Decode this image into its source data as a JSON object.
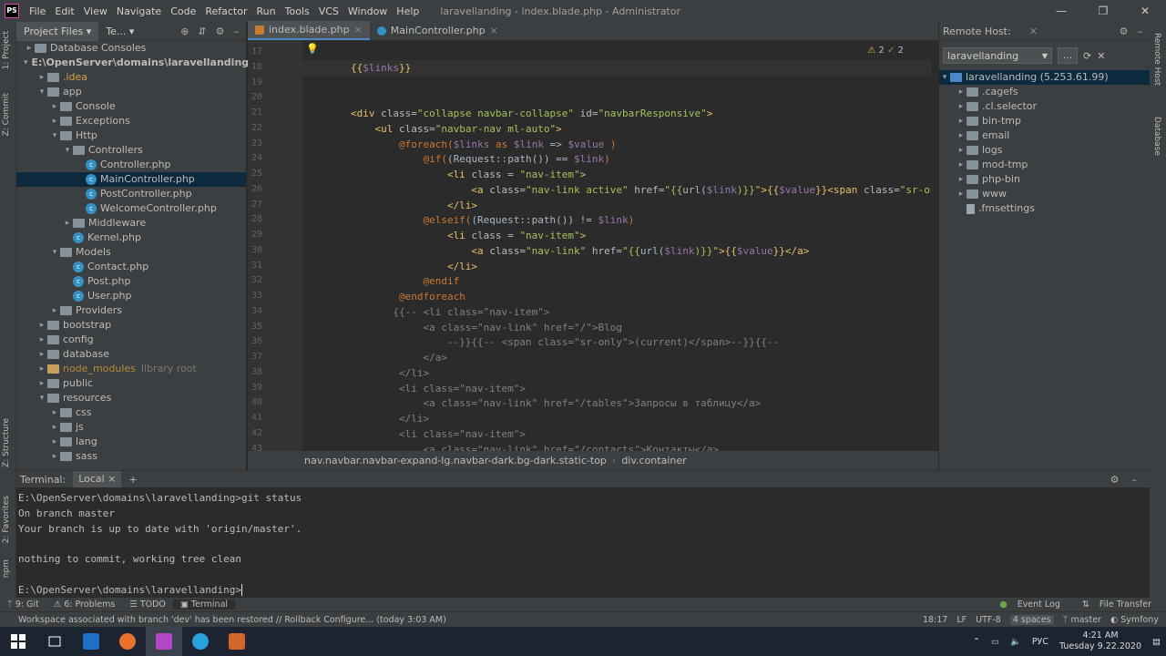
{
  "window": {
    "title": "laravellanding - index.blade.php - Administrator",
    "logo": "PS",
    "controls": [
      "—",
      "❐",
      "✕"
    ]
  },
  "menu": [
    "File",
    "Edit",
    "View",
    "Navigate",
    "Code",
    "Refactor",
    "Run",
    "Tools",
    "VCS",
    "Window",
    "Help"
  ],
  "left_strip": [
    "1: Project",
    "Z: Commit",
    "Z: Structure",
    "2: Favorites",
    "npm"
  ],
  "right_strip": [
    "Remote Host",
    "Database"
  ],
  "project_panel": {
    "tabs": [
      "Project Files",
      "Te..."
    ],
    "tree": [
      {
        "label": "Database Consoles",
        "depth": 1,
        "kind": "folder",
        "expanded": false
      },
      {
        "label": "E:\\OpenServer\\domains\\laravellanding",
        "depth": 1,
        "kind": "folder",
        "expanded": true,
        "bold": true
      },
      {
        "label": ".idea",
        "depth": 2,
        "kind": "folder",
        "expanded": false,
        "style": "idea"
      },
      {
        "label": "app",
        "depth": 2,
        "kind": "folder",
        "expanded": true
      },
      {
        "label": "Console",
        "depth": 3,
        "kind": "folder",
        "expanded": false
      },
      {
        "label": "Exceptions",
        "depth": 3,
        "kind": "folder",
        "expanded": false
      },
      {
        "label": "Http",
        "depth": 3,
        "kind": "folder",
        "expanded": true
      },
      {
        "label": "Controllers",
        "depth": 4,
        "kind": "folder",
        "expanded": true
      },
      {
        "label": "Controller.php",
        "depth": 5,
        "kind": "class"
      },
      {
        "label": "MainController.php",
        "depth": 5,
        "kind": "class",
        "selected": true
      },
      {
        "label": "PostController.php",
        "depth": 5,
        "kind": "class"
      },
      {
        "label": "WelcomeController.php",
        "depth": 5,
        "kind": "class"
      },
      {
        "label": "Middleware",
        "depth": 4,
        "kind": "folder",
        "expanded": false
      },
      {
        "label": "Kernel.php",
        "depth": 4,
        "kind": "class"
      },
      {
        "label": "Models",
        "depth": 3,
        "kind": "folder",
        "expanded": true
      },
      {
        "label": "Contact.php",
        "depth": 4,
        "kind": "class"
      },
      {
        "label": "Post.php",
        "depth": 4,
        "kind": "class"
      },
      {
        "label": "User.php",
        "depth": 4,
        "kind": "class"
      },
      {
        "label": "Providers",
        "depth": 3,
        "kind": "folder",
        "expanded": false
      },
      {
        "label": "bootstrap",
        "depth": 2,
        "kind": "folder",
        "expanded": false
      },
      {
        "label": "config",
        "depth": 2,
        "kind": "folder",
        "expanded": false
      },
      {
        "label": "database",
        "depth": 2,
        "kind": "folder",
        "expanded": false
      },
      {
        "label": "node_modules",
        "depth": 2,
        "kind": "folder",
        "expanded": false,
        "style": "excl",
        "sub": "library root"
      },
      {
        "label": "public",
        "depth": 2,
        "kind": "folder",
        "expanded": false
      },
      {
        "label": "resources",
        "depth": 2,
        "kind": "folder",
        "expanded": true
      },
      {
        "label": "css",
        "depth": 3,
        "kind": "folder",
        "expanded": false
      },
      {
        "label": "js",
        "depth": 3,
        "kind": "folder",
        "expanded": false
      },
      {
        "label": "lang",
        "depth": 3,
        "kind": "folder",
        "expanded": false
      },
      {
        "label": "sass",
        "depth": 3,
        "kind": "folder",
        "expanded": false
      }
    ]
  },
  "editor": {
    "tabs": [
      {
        "label": "index.blade.php",
        "active": true
      },
      {
        "label": "MainController.php",
        "active": false
      }
    ],
    "inspection": {
      "warnings": "2",
      "ok": "2"
    },
    "first_line": 17,
    "current_line": 18,
    "lines": [
      [],
      [
        [
          "        {{",
          "t"
        ],
        [
          "$links",
          "v"
        ],
        [
          "}}",
          "t"
        ]
      ],
      [],
      [],
      [
        [
          "        <div ",
          "t"
        ],
        [
          "class=",
          "a"
        ],
        [
          "\"collapse navbar-collapse\" ",
          "s"
        ],
        [
          "id=",
          "a"
        ],
        [
          "\"navbarResponsive\"",
          "s"
        ],
        [
          ">",
          "t"
        ]
      ],
      [
        [
          "            <ul ",
          "t"
        ],
        [
          "class=",
          "a"
        ],
        [
          "\"navbar-nav ml-auto\"",
          "s"
        ],
        [
          ">",
          "t"
        ]
      ],
      [
        [
          "                @foreach(",
          "b"
        ],
        [
          "$links",
          "v"
        ],
        [
          " as ",
          "b"
        ],
        [
          "$link",
          "v"
        ],
        [
          " => ",
          "p"
        ],
        [
          "$value",
          "v"
        ],
        [
          " )",
          "b"
        ]
      ],
      [
        [
          "                    @if(",
          "b"
        ],
        [
          "(Request::",
          "p"
        ],
        [
          "path",
          "p"
        ],
        [
          "()) == ",
          "p"
        ],
        [
          "$link",
          "v"
        ],
        [
          ")",
          "b"
        ]
      ],
      [
        [
          "                        <li ",
          "t"
        ],
        [
          "class ",
          "a"
        ],
        [
          "= ",
          "p"
        ],
        [
          "\"nav-item\"",
          "s"
        ],
        [
          ">",
          "t"
        ]
      ],
      [
        [
          "                            <a ",
          "t"
        ],
        [
          "class=",
          "a"
        ],
        [
          "\"nav-link active\" ",
          "s"
        ],
        [
          "href=",
          "a"
        ],
        [
          "\"{{",
          "s"
        ],
        [
          "url(",
          "p"
        ],
        [
          "$link",
          "v"
        ],
        [
          ")}}\"",
          "s"
        ],
        [
          ">{{",
          "t"
        ],
        [
          "$value",
          "v"
        ],
        [
          "}}",
          "t"
        ],
        [
          "<span ",
          "t"
        ],
        [
          "class=",
          "a"
        ],
        [
          "\"sr-only\">",
          "s"
        ]
      ],
      [
        [
          "                        </li>",
          "t"
        ]
      ],
      [
        [
          "                    @elseif(",
          "b"
        ],
        [
          "(Request::",
          "p"
        ],
        [
          "path",
          "p"
        ],
        [
          "()) != ",
          "p"
        ],
        [
          "$link",
          "v"
        ],
        [
          ")",
          "b"
        ]
      ],
      [
        [
          "                        <li ",
          "t"
        ],
        [
          "class ",
          "a"
        ],
        [
          "= ",
          "p"
        ],
        [
          "\"nav-item\"",
          "s"
        ],
        [
          ">",
          "t"
        ]
      ],
      [
        [
          "                            <a ",
          "t"
        ],
        [
          "class=",
          "a"
        ],
        [
          "\"nav-link\" ",
          "s"
        ],
        [
          "href=",
          "a"
        ],
        [
          "\"{{",
          "s"
        ],
        [
          "url(",
          "p"
        ],
        [
          "$link",
          "v"
        ],
        [
          ")}}\"",
          "s"
        ],
        [
          ">{{",
          "t"
        ],
        [
          "$value",
          "v"
        ],
        [
          "}}",
          "t"
        ],
        [
          "</a>",
          "t"
        ]
      ],
      [
        [
          "                        </li>",
          "t"
        ]
      ],
      [
        [
          "                    @endif",
          "b"
        ]
      ],
      [
        [
          "                @endforeach",
          "b"
        ]
      ],
      [
        [
          "               {{-- <li class=\"nav-item\">",
          "c"
        ]
      ],
      [
        [
          "                    <a class=\"nav-link\" href=\"/\">Blog",
          "c"
        ]
      ],
      [
        [
          "                        --}}{{-- <span class=\"sr-only\">(current)</span>--}}{{--",
          "c"
        ]
      ],
      [
        [
          "                    </a>",
          "c"
        ]
      ],
      [
        [
          "                </li>",
          "c"
        ]
      ],
      [
        [
          "                <li class=\"nav-item\">",
          "c"
        ]
      ],
      [
        [
          "                    <a class=\"nav-link\" href=\"/tables\">Запросы в таблицу</a>",
          "c"
        ]
      ],
      [
        [
          "                </li>",
          "c"
        ]
      ],
      [
        [
          "                <li class=\"nav-item\">",
          "c"
        ]
      ],
      [
        [
          "                    <a class=\"nav-link\" href=\"/contacts\">Контакты</a>",
          "c"
        ]
      ]
    ],
    "breadcrumb": [
      "nav.navbar.navbar-expand-lg.navbar-dark.bg-dark.static-top",
      "div.container"
    ]
  },
  "remote_host": {
    "title": "Remote Host:",
    "host_select": "laravellanding",
    "more_button": "...",
    "root": "laravellanding (5.253.61.99)",
    "items": [
      {
        "label": ".cagefs",
        "kind": "folder"
      },
      {
        "label": ".cl.selector",
        "kind": "folder"
      },
      {
        "label": "bin-tmp",
        "kind": "folder"
      },
      {
        "label": "email",
        "kind": "folder"
      },
      {
        "label": "logs",
        "kind": "folder"
      },
      {
        "label": "mod-tmp",
        "kind": "folder"
      },
      {
        "label": "php-bin",
        "kind": "folder"
      },
      {
        "label": "www",
        "kind": "folder"
      },
      {
        "label": ".fmsettings",
        "kind": "file"
      }
    ]
  },
  "terminal": {
    "title": "Terminal:",
    "tab": "Local",
    "add": "+",
    "lines": [
      "E:\\OpenServer\\domains\\laravellanding>git status",
      "On branch master",
      "Your branch is up to date with 'origin/master'.",
      "",
      "nothing to commit, working tree clean",
      "",
      "E:\\OpenServer\\domains\\laravellanding>"
    ]
  },
  "tool_windows": {
    "left": [
      {
        "label": "9: Git",
        "active": false
      },
      {
        "label": "6: Problems",
        "active": false
      },
      {
        "label": "TODO",
        "active": false
      },
      {
        "label": "Terminal",
        "active": true
      }
    ],
    "right": [
      "Event Log",
      "File Transfer"
    ]
  },
  "status": {
    "message": "Workspace associated with branch 'dev' has been restored // Rollback    Configure... (today 3:03 AM)",
    "position": "18:17",
    "line_sep": "LF",
    "encoding": "UTF-8",
    "indent": "4 spaces",
    "branch": "master",
    "framework": "Symfony"
  },
  "taskbar": {
    "apps": [
      "windows-start",
      "task-view",
      "outlook",
      "firefox",
      "phpstorm",
      "telegram",
      "game"
    ],
    "active_app": "phpstorm",
    "lang": "РУС",
    "time": "4:21 AM",
    "date": "Tuesday 9.22.2020"
  }
}
